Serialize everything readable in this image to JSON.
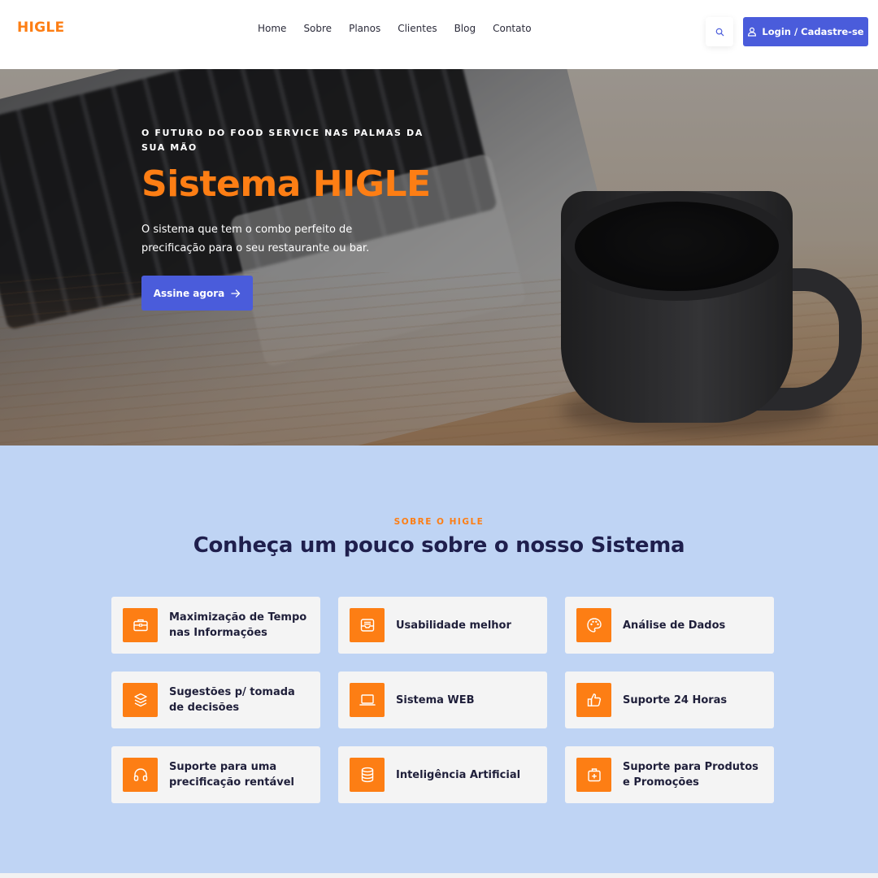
{
  "header": {
    "logo": "HIGLE",
    "nav": [
      "Home",
      "Sobre",
      "Planos",
      "Clientes",
      "Blog",
      "Contato"
    ],
    "login_label": "Login / Cadastre-se"
  },
  "hero": {
    "kicker": "O FUTURO DO FOOD SERVICE NAS PALMAS DA SUA MÃO",
    "title": "Sistema HIGLE",
    "description": "O sistema que tem o combo perfeito de precificação para o seu restaurante ou bar.",
    "cta_label": "Assine agora"
  },
  "about": {
    "kicker": "SOBRE O HIGLE",
    "title": "Conheça um pouco sobre o nosso Sistema",
    "features": [
      {
        "label": "Maximização de Tempo nas Informações",
        "icon": "briefcase-icon"
      },
      {
        "label": "Usabilidade melhor",
        "icon": "inbox-icon"
      },
      {
        "label": "Análise de Dados",
        "icon": "palette-icon"
      },
      {
        "label": "Sugestões p/ tomada de decisões",
        "icon": "layers-icon"
      },
      {
        "label": "Sistema WEB",
        "icon": "laptop-icon"
      },
      {
        "label": "Suporte 24 Horas",
        "icon": "thumbs-up-icon"
      },
      {
        "label": "Suporte para uma precificação rentável",
        "icon": "headphones-icon"
      },
      {
        "label": "Inteligência Artificial",
        "icon": "database-icon"
      },
      {
        "label": "Suporte para Produtos e Promoções",
        "icon": "first-aid-icon"
      }
    ]
  },
  "colors": {
    "accent": "#fd7e14",
    "primary": "#4a5cdb",
    "about_bg": "#bfd4f4",
    "heading": "#1f1f4d"
  }
}
